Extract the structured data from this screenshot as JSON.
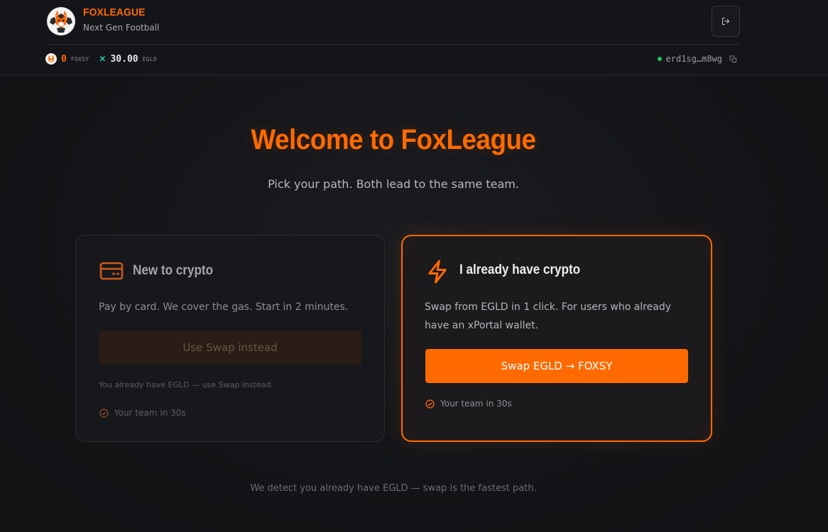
{
  "header": {
    "brand_name": "FOXLEAGUE",
    "brand_tagline": "Next Gen Football",
    "logout_icon": "logout-icon"
  },
  "balances": {
    "foxsy_amount": "0",
    "foxsy_unit": "FOXSY",
    "egld_amount": "30.00",
    "egld_unit": "EGLD"
  },
  "wallet": {
    "address": "erd1sg…m8wg",
    "status_color": "#22c55e"
  },
  "hero": {
    "title": "Welcome to FoxLeague",
    "subtitle": "Pick your path. Both lead to the same team."
  },
  "cards": {
    "new_to_crypto": {
      "icon": "credit-card-icon",
      "title": "New to crypto",
      "description": "Pay by card. We cover the gas. Start in 2 minutes.",
      "button_label": "Use Swap instead",
      "note": "You already have EGLD — use Swap instead.",
      "feature": "Your team in 30s"
    },
    "have_crypto": {
      "icon": "lightning-icon",
      "title": "I already have crypto",
      "description": "Swap from EGLD in 1 click. For users who already have an xPortal wallet.",
      "button_label": "Swap EGLD → FOXSY",
      "feature": "Your team in 30s"
    }
  },
  "footer": {
    "note": "We detect you already have EGLD — swap is the fastest path."
  },
  "colors": {
    "accent": "#ff6a00",
    "background": "#141518",
    "egld": "#23f7dd"
  }
}
